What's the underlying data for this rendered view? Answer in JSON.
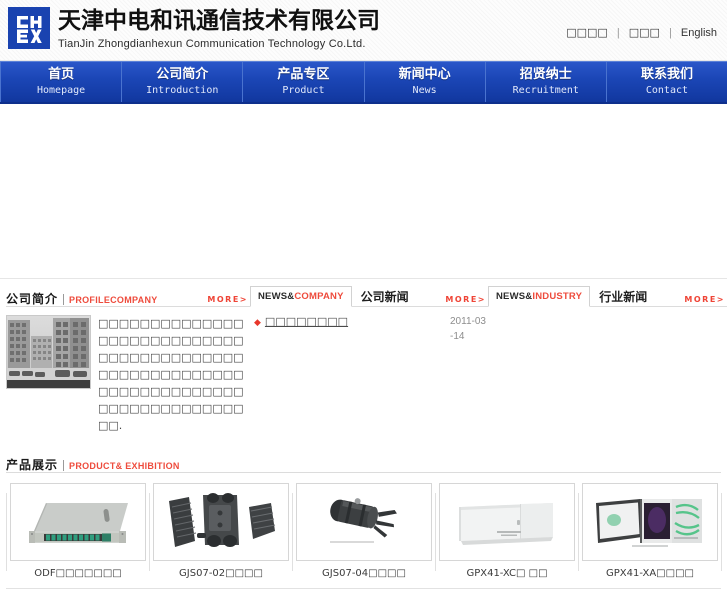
{
  "header": {
    "logo_alt": "CHEX logo",
    "company_name_cn": "天津中电和讯通信技术有限公司",
    "company_name_en": "TianJin Zhongdianhexun Communication Technology Co.Ltd.",
    "lang_links": [
      {
        "label": "□□□□",
        "name": "add-favorite-link"
      },
      {
        "label": "□□□",
        "name": "set-homepage-link"
      },
      {
        "label": "English",
        "name": "english-link"
      }
    ],
    "separator": "|"
  },
  "nav": {
    "items": [
      {
        "cn": "首页",
        "en": "Homepage"
      },
      {
        "cn": "公司简介",
        "en": "Introduction"
      },
      {
        "cn": "产品专区",
        "en": "Product"
      },
      {
        "cn": "新闻中心",
        "en": "News"
      },
      {
        "cn": "招贤纳士",
        "en": "Recruitment"
      },
      {
        "cn": "联系我们",
        "en": "Contact"
      }
    ]
  },
  "profile": {
    "title_cn": "公司简介",
    "title_en": "PROFILECOMPANY",
    "more": "MORE>",
    "body_text": "□□□□□□□□□□□□□□□□□□□□□□□□□□□□□□□□□□□□□□□□□□□□□□□□□□□□□□□□□□□□□□□□□□□□□□□□□□□□□□□□□□□□□□."
  },
  "news_company": {
    "tab_active_part1": "NEWS&",
    "tab_active_part2": "COMPANY",
    "tab_plain": "公司新闻",
    "more": "MORE>",
    "items": [
      {
        "bullet": "◆",
        "title": "□□□□□□□□",
        "date": "2011-03-14"
      }
    ]
  },
  "news_industry": {
    "tab_active_part1": "NEWS&",
    "tab_active_part2": "INDUSTRY",
    "tab_plain": "行业新闻",
    "more": "MORE>",
    "items": []
  },
  "products": {
    "title_cn": "产品展示",
    "title_en": "PRODUCT& EXHIBITION",
    "items": [
      {
        "caption": "ODF□□□□□□□",
        "image": "odf-rack-unit"
      },
      {
        "caption": "GJS07-02□□□□",
        "image": "splice-closure-flat"
      },
      {
        "caption": "GJS07-04□□□□",
        "image": "splice-closure-dome"
      },
      {
        "caption": "GPX41-XC□ □□",
        "image": "wall-cabinet"
      },
      {
        "caption": "GPX41-XA□□□□",
        "image": "distribution-box-open"
      }
    ]
  },
  "colors": {
    "nav_blue": "#1944b4",
    "accent_red": "#ee4b3c",
    "logo_blue": "#1a43b0",
    "text_dark": "#1a1a1a",
    "text_muted": "#8d8d8d"
  }
}
